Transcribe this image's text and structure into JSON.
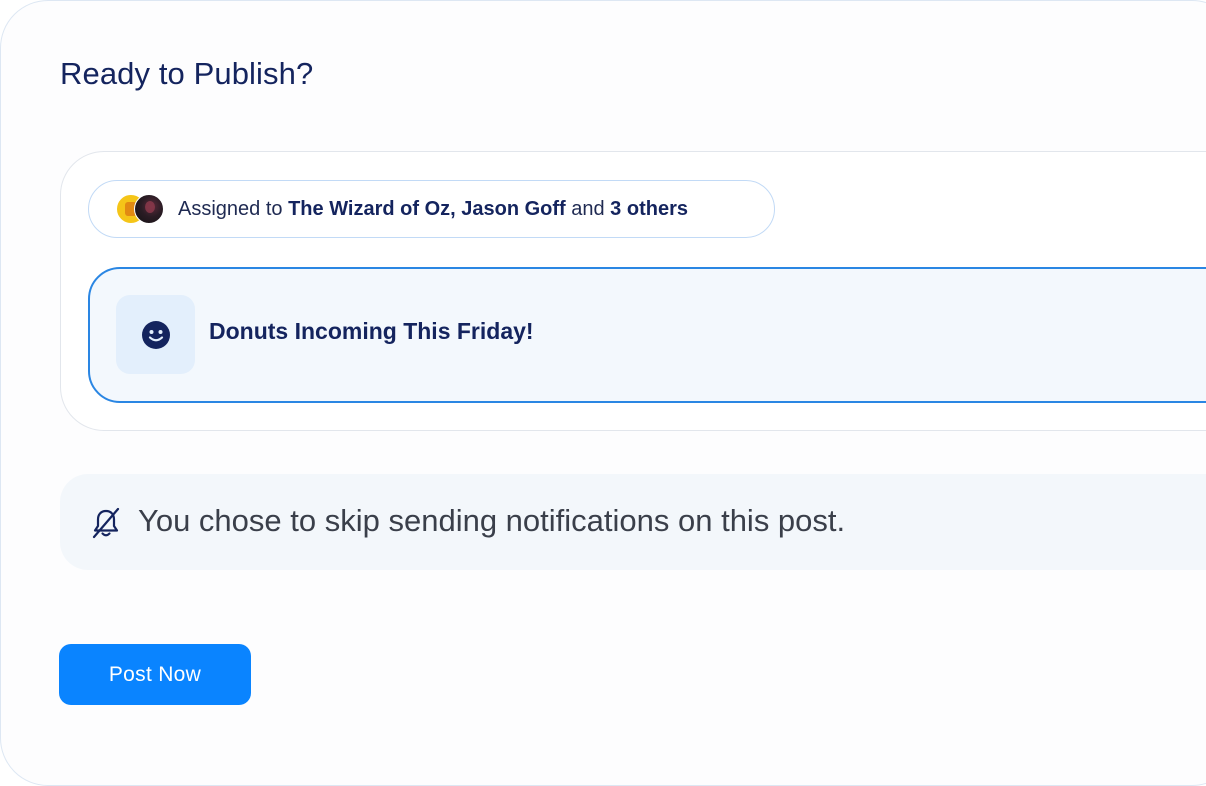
{
  "page": {
    "title": "Ready to Publish?"
  },
  "assignment": {
    "prefix": "Assigned to ",
    "assignees": "The Wizard of Oz, Jason Goff",
    "conjunction": " and ",
    "others": "3 others",
    "avatars": [
      "avatar-wizard-of-oz",
      "avatar-jason-goff"
    ]
  },
  "post": {
    "title": "Donuts Incoming This Friday!",
    "icon": "smiley-icon"
  },
  "notification": {
    "icon": "bell-off-icon",
    "message": "You chose to skip sending notifications on this post."
  },
  "actions": {
    "post_now_label": "Post Now"
  },
  "colors": {
    "accent": "#0a84ff",
    "heading": "#14245e",
    "post_border": "#2a86e3"
  }
}
